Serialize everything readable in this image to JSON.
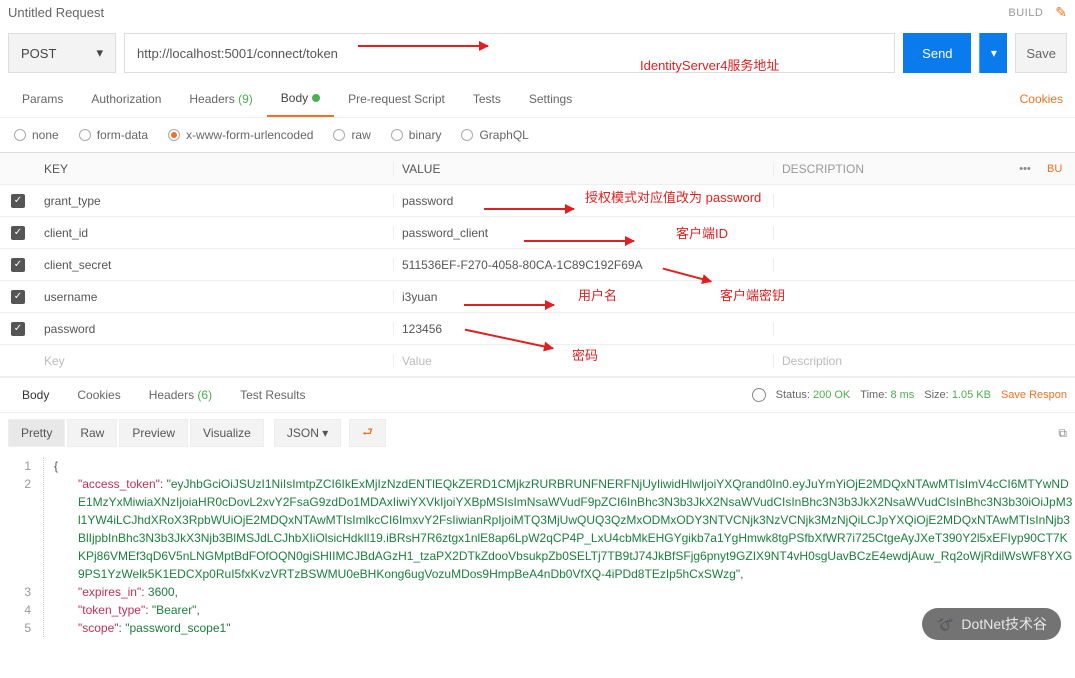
{
  "header": {
    "title": "Untitled Request",
    "build": "BUILD",
    "save": "Save"
  },
  "request": {
    "method": "POST",
    "url": "http://localhost:5001/connect/token",
    "send": "Send",
    "annotation_url": "IdentityServer4服务地址"
  },
  "tabs": {
    "params": "Params",
    "auth": "Authorization",
    "headers": "Headers",
    "headers_count": "(9)",
    "body": "Body",
    "prerequest": "Pre-request Script",
    "tests": "Tests",
    "settings": "Settings",
    "cookies": "Cookies"
  },
  "body_types": {
    "none": "none",
    "formdata": "form-data",
    "xwww": "x-www-form-urlencoded",
    "raw": "raw",
    "binary": "binary",
    "graphql": "GraphQL"
  },
  "table": {
    "key_h": "KEY",
    "value_h": "VALUE",
    "desc_h": "DESCRIPTION",
    "more": "•••",
    "bu": "Bu",
    "key_ph": "Key",
    "value_ph": "Value",
    "desc_ph": "Description",
    "rows": [
      {
        "key": "grant_type",
        "value": "password"
      },
      {
        "key": "client_id",
        "value": "password_client"
      },
      {
        "key": "client_secret",
        "value": "511536EF-F270-4058-80CA-1C89C192F69A"
      },
      {
        "key": "username",
        "value": "i3yuan"
      },
      {
        "key": "password",
        "value": "123456"
      }
    ]
  },
  "annotations": {
    "grant": "授权模式对应值改为 password",
    "clientid": "客户端ID",
    "secret": "客户端密钥",
    "user": "用户名",
    "pass": "密码"
  },
  "rtabs": {
    "body": "Body",
    "cookies": "Cookies",
    "headers": "Headers",
    "headers_count": "(6)",
    "results": "Test Results"
  },
  "status": {
    "status_l": "Status:",
    "status_v": "200 OK",
    "time_l": "Time:",
    "time_v": "8 ms",
    "size_l": "Size:",
    "size_v": "1.05 KB",
    "save": "Save Respon"
  },
  "view": {
    "pretty": "Pretty",
    "raw": "Raw",
    "preview": "Preview",
    "visualize": "Visualize",
    "fmt": "JSON"
  },
  "json": {
    "lines": [
      "1",
      "2",
      "3",
      "4",
      "5"
    ],
    "brace": "{",
    "access_token_k": "\"access_token\"",
    "access_token_v": "\"eyJhbGciOiJSUzI1NiIsImtpZCI6IkExMjIzNzdENTlEQkZERD1CMjkzRURBRUNFNERFNjUyIiwidHlwIjoiYXQrand0In0.eyJuYmYiOjE2MDQxNTAwMTIsImV4cCI6MTYwNDE1MzYxMiwiaXNzIjoiaHR0cDovL2xvY2FsaG9zdDo1MDAxIiwiYXVkIjoiYXBpMSIsImNsaWVudF9pZCI6InBhc3N3b3JkX2NsaWVudCIsInBhc3N3b3JkX2NsaWVudCIsInBhc3N3b30iOiJpM3l1YW4iLCJhdXRoX3RpbWUiOjE2MDQxNTAwMTIsImlkcCI6ImxvY2FsIiwianRpIjoiMTQ3MjUwQUQ3QzMxODMxODY3NTVCNjk3NzVCNjk3MzNjQiLCJpYXQiOjE2MDQxNTAwMTIsInNjb3BlIjpbInBhc3N3b3JkX3Njb3BlMSJdLCJhbXIiOlsicHdkIl19.iBRsH7R6ztgx1nlE8ap6LpW2qCP4P_LxU4cbMkEHGYgikb7a1YgHmwk8tgPSfbXfWR7i725CtgeAyJXeT390Y2l5xEFIyp90CT7KKPj86VMEf3qD6V5nLNGMptBdFOfOQN0giSHIIMCJBdAGzH1_tzaPX2DTkZdooVbsukpZb0SELTj7TB9tJ74JkBfSFjg6pnyt9GZIX9NT4vH0sgUavBCzE4ewdjAuw_Rq2oWjRdilWsWF8YXG9PS1YzWelk5K1EDCXp0RuI5fxKvzVRTzBSWMU0eBHKong6ugVozuMDos9HmpBeA4nDb0VfXQ-4iPDd8TEzIp5hCxSWzg\"",
    "expires_k": "\"expires_in\"",
    "expires_v": "3600",
    "token_type_k": "\"token_type\"",
    "token_type_v": "\"Bearer\"",
    "scope_k": "\"scope\"",
    "scope_v": "\"password_scope1\""
  },
  "watermark": "DotNet技术谷"
}
